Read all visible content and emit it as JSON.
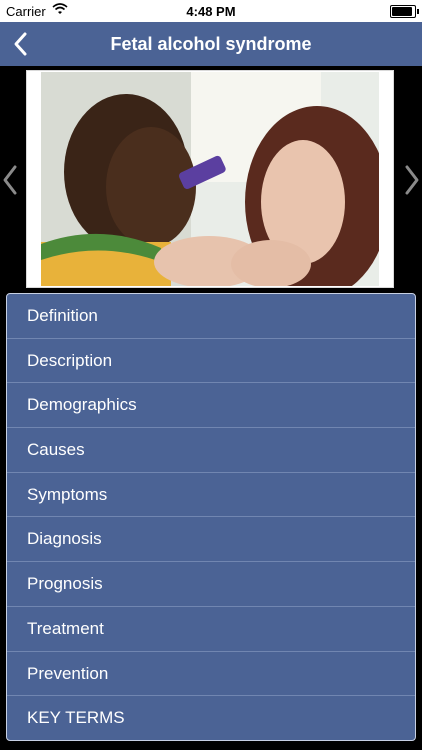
{
  "status_bar": {
    "carrier": "Carrier",
    "time": "4:48 PM"
  },
  "nav": {
    "title": "Fetal alcohol syndrome"
  },
  "icons": {
    "back": "chevron-left-icon",
    "prev": "chevron-left-icon",
    "next": "chevron-right-icon",
    "wifi": "wifi-icon",
    "battery": "battery-icon"
  },
  "colors": {
    "nav_background": "#4b6395",
    "menu_background": "#4b6395"
  },
  "menu": {
    "items": [
      {
        "label": "Definition"
      },
      {
        "label": "Description"
      },
      {
        "label": "Demographics"
      },
      {
        "label": "Causes"
      },
      {
        "label": "Symptoms"
      },
      {
        "label": "Diagnosis"
      },
      {
        "label": "Prognosis"
      },
      {
        "label": "Treatment"
      },
      {
        "label": "Prevention"
      },
      {
        "label": "KEY TERMS"
      }
    ]
  }
}
